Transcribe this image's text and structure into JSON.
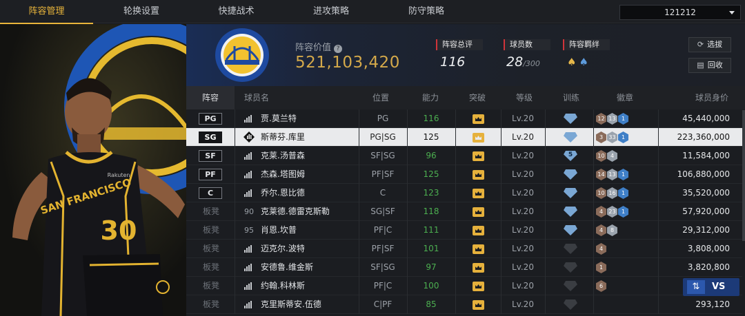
{
  "tabs": [
    {
      "label": "阵容管理",
      "active": true
    },
    {
      "label": "轮换设置",
      "active": false
    },
    {
      "label": "快捷战术",
      "active": false
    },
    {
      "label": "进攻策略",
      "active": false
    },
    {
      "label": "防守策略",
      "active": false
    }
  ],
  "lineup_select": {
    "value": "121212"
  },
  "summary": {
    "value_label": "阵容价值",
    "value": "521,103,420",
    "rating_label": "阵容总评",
    "rating": "116",
    "count_label": "球员数",
    "count": "28",
    "count_max": "/300",
    "bond_label": "阵容羁绊",
    "select_button": "选拔",
    "recycle_button": "回收"
  },
  "table": {
    "headers": [
      "阵容",
      "球员名",
      "位置",
      "能力",
      "突破",
      "等级",
      "训练",
      "徽章",
      "球员身价"
    ],
    "rows": [
      {
        "slot": "PG",
        "starter": true,
        "icon": "signal",
        "name": "贾.莫兰特",
        "position": "PG",
        "ability": "116",
        "level": "Lv.20",
        "train": "",
        "medals": [
          "12",
          "13",
          "1"
        ],
        "salary": "45,440,000",
        "selected": false
      },
      {
        "slot": "SG",
        "starter": true,
        "icon": "diamond",
        "name": "斯蒂芬.库里",
        "position": "PG|SG",
        "ability": "125",
        "level": "Lv.20",
        "train": "",
        "medals": [
          "3",
          "33",
          "1"
        ],
        "salary": "223,360,000",
        "selected": true
      },
      {
        "slot": "SF",
        "starter": true,
        "icon": "signal",
        "name": "克莱.汤普森",
        "position": "SF|SG",
        "ability": "96",
        "level": "Lv.20",
        "train": "5",
        "medals": [
          "10",
          "4"
        ],
        "salary": "11,584,000",
        "selected": false
      },
      {
        "slot": "PF",
        "starter": true,
        "icon": "signal",
        "name": "杰森.塔图姆",
        "position": "PF|SF",
        "ability": "125",
        "level": "Lv.20",
        "train": "",
        "medals": [
          "14",
          "13",
          "1"
        ],
        "salary": "106,880,000",
        "selected": false
      },
      {
        "slot": "C",
        "starter": true,
        "icon": "signal",
        "name": "乔尔.恩比德",
        "position": "C",
        "ability": "123",
        "level": "Lv.20",
        "train": "",
        "medals": [
          "10",
          "16",
          "1"
        ],
        "salary": "35,520,000",
        "selected": false
      },
      {
        "slot": "板凳",
        "starter": false,
        "icon": "90",
        "name": "克莱德.德雷克斯勒",
        "position": "SG|SF",
        "ability": "118",
        "level": "Lv.20",
        "train": "",
        "medals": [
          "4",
          "23",
          "1"
        ],
        "salary": "57,920,000",
        "selected": false
      },
      {
        "slot": "板凳",
        "starter": false,
        "icon": "95",
        "name": "肖恩.坎普",
        "position": "PF|C",
        "ability": "111",
        "level": "Lv.20",
        "train": "",
        "medals": [
          "4",
          "8"
        ],
        "salary": "29,312,000",
        "selected": false
      },
      {
        "slot": "板凳",
        "starter": false,
        "icon": "signal",
        "name": "迈克尔.波特",
        "position": "PF|SF",
        "ability": "101",
        "level": "Lv.20",
        "train": "",
        "medals": [
          "4"
        ],
        "salary": "3,808,000",
        "selected": false
      },
      {
        "slot": "板凳",
        "starter": false,
        "icon": "signal",
        "name": "安德鲁.维金斯",
        "position": "SF|SG",
        "ability": "97",
        "level": "Lv.20",
        "train": "",
        "medals": [
          "1"
        ],
        "salary": "3,820,800",
        "selected": false
      },
      {
        "slot": "板凳",
        "starter": false,
        "icon": "signal",
        "name": "约翰.科林斯",
        "position": "PF|C",
        "ability": "100",
        "level": "Lv.20",
        "train": "",
        "medals": [
          "6"
        ],
        "salary": "",
        "selected": false
      },
      {
        "slot": "板凳",
        "starter": false,
        "icon": "signal",
        "name": "克里斯蒂安.伍德",
        "position": "C|PF",
        "ability": "85",
        "level": "Lv.20",
        "train": "",
        "medals": [],
        "salary": "293,120",
        "selected": false
      }
    ]
  },
  "portrait": {
    "jersey_team": "SAN FRANCISCO",
    "jersey_number": "30",
    "jersey_sponsor": "Rakuten"
  },
  "vs_button": {
    "label": "VS"
  },
  "colors": {
    "accent": "#e9b53b",
    "ability_green": "#4caf50",
    "rating_red": "#d0343a",
    "team_blue": "#1a2d55"
  }
}
